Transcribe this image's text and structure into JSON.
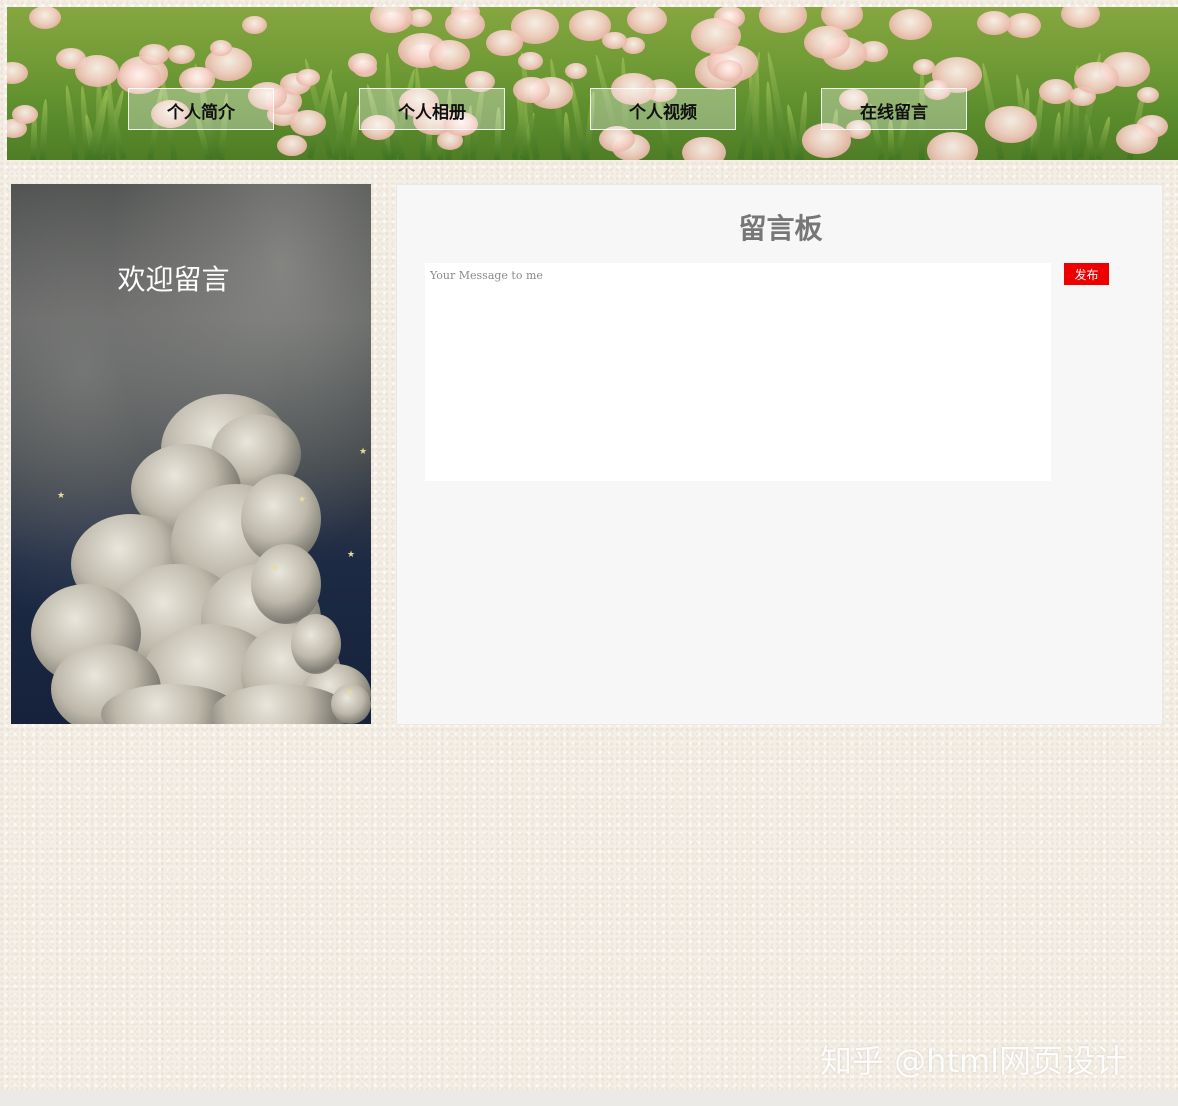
{
  "nav": {
    "items": [
      {
        "label": "个人简介"
      },
      {
        "label": "个人相册"
      },
      {
        "label": "个人视频"
      },
      {
        "label": "在线留言"
      }
    ]
  },
  "sidebar": {
    "welcome_text": "欢迎留言"
  },
  "board": {
    "title": "留言板",
    "message_placeholder": "Your Message to me",
    "message_value": "",
    "post_label": "发布"
  },
  "watermark": {
    "text": "知乎 @html网页设计"
  },
  "colors": {
    "post_button": "#ee0000",
    "title_text": "#777777",
    "board_bg": "#f7f7f7"
  }
}
